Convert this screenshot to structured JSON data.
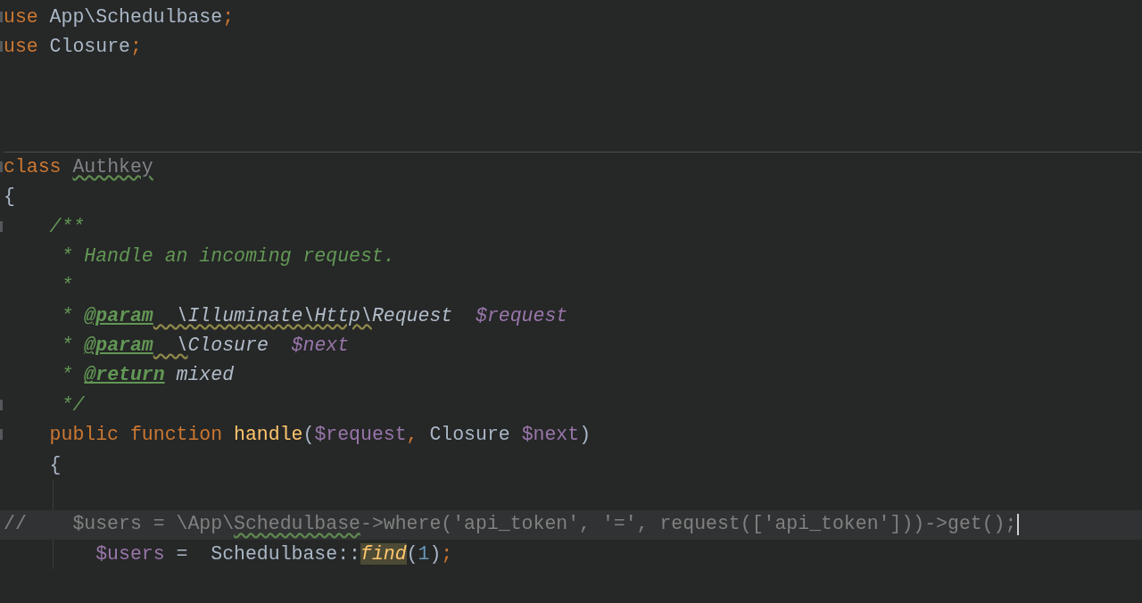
{
  "editor": {
    "lines": [
      {
        "kind": "code",
        "fold": true,
        "tokens": [
          {
            "text": "use",
            "kind": "keyword"
          },
          {
            "text": " App\\Schedulbase",
            "kind": "plain"
          },
          {
            "text": ";",
            "kind": "keyword"
          }
        ]
      },
      {
        "kind": "code",
        "fold": true,
        "tokens": [
          {
            "text": "use",
            "kind": "keyword"
          },
          {
            "text": " Closure",
            "kind": "plain"
          },
          {
            "text": ";",
            "kind": "keyword"
          }
        ]
      },
      {
        "kind": "blank"
      },
      {
        "kind": "blank"
      },
      {
        "kind": "blank"
      },
      {
        "kind": "code",
        "fold": true,
        "separator_above": true,
        "tokens": [
          {
            "text": "class ",
            "kind": "keyword"
          },
          {
            "text": "Authkey",
            "kind": "unused",
            "misspelled": true
          }
        ]
      },
      {
        "kind": "code",
        "tokens": [
          {
            "text": "{",
            "kind": "plain"
          }
        ]
      },
      {
        "kind": "code",
        "fold": true,
        "tokens": [
          {
            "text": "    /**",
            "kind": "doc"
          }
        ]
      },
      {
        "kind": "code",
        "tokens": [
          {
            "text": "     * Handle an incoming request.",
            "kind": "doc"
          }
        ]
      },
      {
        "kind": "code",
        "tokens": [
          {
            "text": "     *",
            "kind": "doc"
          }
        ]
      },
      {
        "kind": "code",
        "tokens": [
          {
            "text": "     * ",
            "kind": "doc"
          },
          {
            "text": "@param",
            "kind": "doc-tag"
          },
          {
            "text": "  \\Illuminate\\Http\\",
            "kind": "doc-type",
            "warning": true
          },
          {
            "text": "Request  ",
            "kind": "doc-type"
          },
          {
            "text": "$request",
            "kind": "doc-var"
          }
        ]
      },
      {
        "kind": "code",
        "tokens": [
          {
            "text": "     * ",
            "kind": "doc"
          },
          {
            "text": "@param",
            "kind": "doc-tag"
          },
          {
            "text": "  \\",
            "kind": "doc-type",
            "warning": true
          },
          {
            "text": "Closure  ",
            "kind": "doc-type"
          },
          {
            "text": "$next",
            "kind": "doc-var"
          }
        ]
      },
      {
        "kind": "code",
        "tokens": [
          {
            "text": "     * ",
            "kind": "doc"
          },
          {
            "text": "@return",
            "kind": "doc-tag"
          },
          {
            "text": " mixed",
            "kind": "doc-type"
          }
        ]
      },
      {
        "kind": "code",
        "fold": true,
        "tokens": [
          {
            "text": "     */",
            "kind": "doc"
          }
        ]
      },
      {
        "kind": "code",
        "fold": true,
        "tokens": [
          {
            "text": "    public function ",
            "kind": "keyword"
          },
          {
            "text": "handle",
            "kind": "function"
          },
          {
            "text": "(",
            "kind": "plain"
          },
          {
            "text": "$request",
            "kind": "variable"
          },
          {
            "text": ", ",
            "kind": "keyword"
          },
          {
            "text": "Closure ",
            "kind": "plain"
          },
          {
            "text": "$next",
            "kind": "variable"
          },
          {
            "text": ")",
            "kind": "plain"
          }
        ]
      },
      {
        "kind": "code",
        "tokens": [
          {
            "text": "    {",
            "kind": "plain"
          }
        ]
      },
      {
        "kind": "blank",
        "indent_guide": true
      },
      {
        "kind": "code",
        "current": true,
        "tokens": [
          {
            "text": "//    $users = \\App\\",
            "kind": "comment"
          },
          {
            "text": "Schedulbase",
            "kind": "comment",
            "misspelled": true
          },
          {
            "text": "->where('api_token', '=', request(['api_token']))->get();",
            "kind": "comment"
          }
        ]
      },
      {
        "kind": "code",
        "indent_guide": true,
        "tokens": [
          {
            "text": "        $users",
            "kind": "variable"
          },
          {
            "text": " =  Schedulbase::",
            "kind": "plain"
          },
          {
            "text": "find",
            "kind": "static-call",
            "highlighted": true
          },
          {
            "text": "(",
            "kind": "plain"
          },
          {
            "text": "1",
            "kind": "number"
          },
          {
            "text": ")",
            "kind": "plain"
          },
          {
            "text": ";",
            "kind": "keyword"
          }
        ]
      }
    ]
  }
}
